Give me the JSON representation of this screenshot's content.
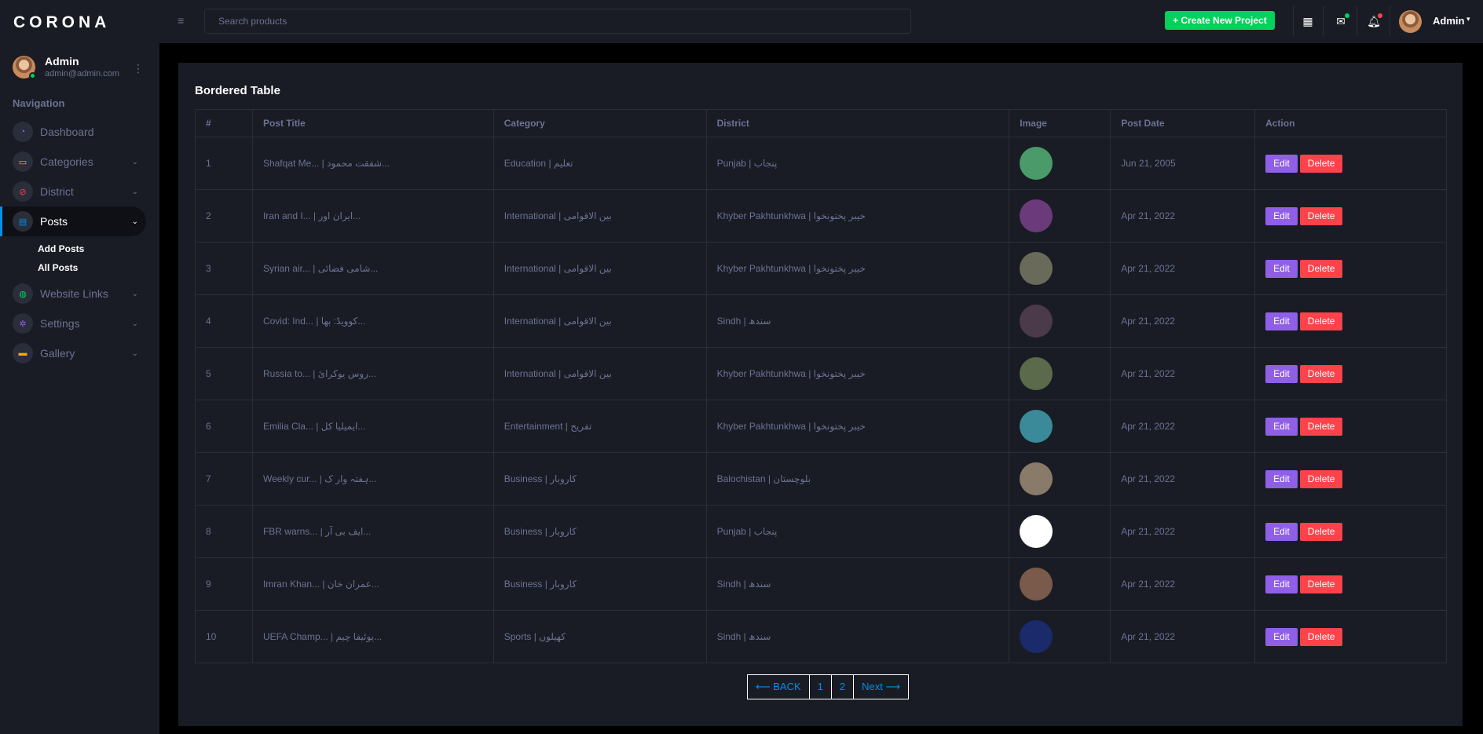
{
  "brand": "CORONA",
  "profile": {
    "name": "Admin",
    "email": "admin@admin.com"
  },
  "nav": {
    "heading": "Navigation",
    "items": [
      {
        "label": "Dashboard",
        "icon": "speedometer-icon",
        "color": "#8f5fe8"
      },
      {
        "label": "Categories",
        "icon": "laptop-icon",
        "color": "#ffab00"
      },
      {
        "label": "District",
        "icon": "block-icon",
        "color": "#fc424a"
      },
      {
        "label": "Posts",
        "icon": "document-icon",
        "color": "#0090e7"
      },
      {
        "label": "Website Links",
        "icon": "globe-icon",
        "color": "#00d25b"
      },
      {
        "label": "Settings",
        "icon": "gear-icon",
        "color": "#8f5fe8"
      },
      {
        "label": "Gallery",
        "icon": "chat-icon",
        "color": "#ffab00"
      }
    ],
    "sub_items": [
      "Add Posts",
      "All Posts"
    ]
  },
  "topbar": {
    "search_placeholder": "Search products",
    "create_label": "+ Create New Project",
    "user": "Admin"
  },
  "card_title": "Bordered Table",
  "columns": [
    "#",
    "Post Title",
    "Category",
    "District",
    "Image",
    "Post Date",
    "Action"
  ],
  "rows": [
    {
      "num": "1",
      "title": "Shafqat Me... | شفقت محمود...",
      "category": "Education | تعلیم",
      "district": "Punjab | پنجاب",
      "date": "Jun 21, 2005",
      "thumb": "#4a9a6a"
    },
    {
      "num": "2",
      "title": "Iran and I... | ایران اور...",
      "category": "International | بین الاقوامی",
      "district": "Khyber Pakhtunkhwa | خیبر پختونخوا",
      "date": "Apr 21, 2022",
      "thumb": "#6a3a7a"
    },
    {
      "num": "3",
      "title": "Syrian air... | شامی فضائی...",
      "category": "International | بین الاقوامی",
      "district": "Khyber Pakhtunkhwa | خیبر پختونخوا",
      "date": "Apr 21, 2022",
      "thumb": "#6a6a5a"
    },
    {
      "num": "4",
      "title": "Covid: Ind... | کوویڈ: بھا...",
      "category": "International | بین الاقوامی",
      "district": "Sindh | سندھ",
      "date": "Apr 21, 2022",
      "thumb": "#4a3a4a"
    },
    {
      "num": "5",
      "title": "Russia to... | روس یوکرائ...",
      "category": "International | بین الاقوامی",
      "district": "Khyber Pakhtunkhwa | خیبر پختونخوا",
      "date": "Apr 21, 2022",
      "thumb": "#5a6a4a"
    },
    {
      "num": "6",
      "title": "Emilia Cla... | ایمیلیا کل...",
      "category": "Entertainment | تفریح",
      "district": "Khyber Pakhtunkhwa | خیبر پختونخوا",
      "date": "Apr 21, 2022",
      "thumb": "#3a8a9a"
    },
    {
      "num": "7",
      "title": "Weekly cur... | ہفتہ وار ک...",
      "category": "Business | کاروبار",
      "district": "Balochistan | بلوچستان",
      "date": "Apr 21, 2022",
      "thumb": "#8a7a6a"
    },
    {
      "num": "8",
      "title": "FBR warns... | ایف بی آر...",
      "category": "Business | کاروبار",
      "district": "Punjab | پنجاب",
      "date": "Apr 21, 2022",
      "thumb": "#ffffff"
    },
    {
      "num": "9",
      "title": "Imran Khan... | عمران خان...",
      "category": "Business | کاروبار",
      "district": "Sindh | سندھ",
      "date": "Apr 21, 2022",
      "thumb": "#7a5a4a"
    },
    {
      "num": "10",
      "title": "UEFA Champ... | یوئیفا چیم...",
      "category": "Sports | کھیلوں",
      "district": "Sindh | سندھ",
      "date": "Apr 21, 2022",
      "thumb": "#1a2a6a"
    }
  ],
  "actions": {
    "edit": "Edit",
    "delete": "Delete"
  },
  "pagination": [
    "⟵ BACK",
    "1",
    "2",
    "Next ⟶"
  ]
}
